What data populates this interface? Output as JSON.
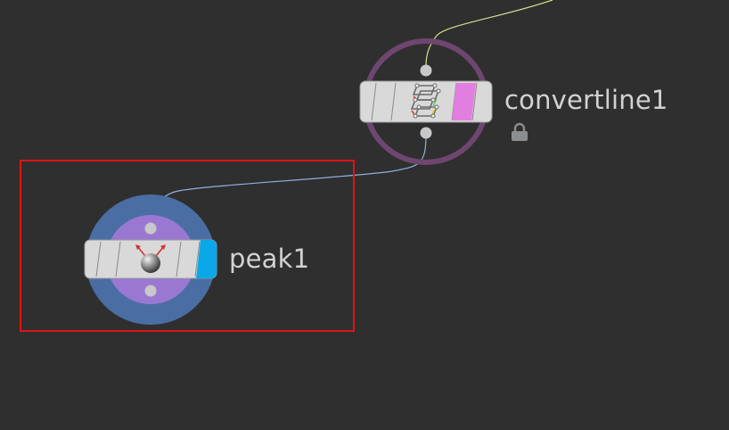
{
  "network": {
    "nodes": [
      {
        "name": "convertline1",
        "type_icon": "convertline-icon",
        "flag_color": "#e27ee0",
        "ring_color": "#6e4670",
        "locked": true,
        "selected": false
      },
      {
        "name": "peak1",
        "type_icon": "peak-icon",
        "flag_color": "#0aa8e8",
        "ring_color": "#4a6ea3",
        "inner_color": "#9a78d2",
        "locked": false,
        "selected": true
      }
    ],
    "connections": [
      {
        "from": "upstream",
        "to": "convertline1",
        "color": "#d7dc8a"
      },
      {
        "from": "convertline1",
        "to": "peak1",
        "color": "#8fb1dc"
      }
    ],
    "selection_color": "#e01414",
    "background_color": "#2f2f2f"
  }
}
